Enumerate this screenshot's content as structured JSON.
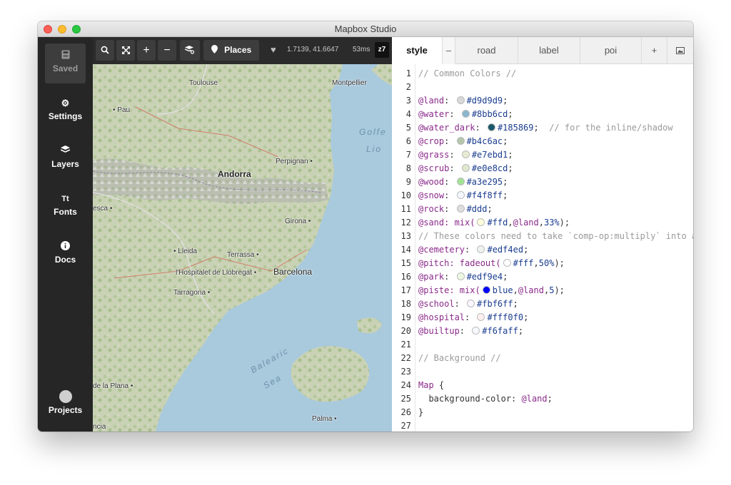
{
  "window": {
    "title": "Mapbox Studio"
  },
  "sidebar": {
    "items": [
      {
        "label": "Saved",
        "icon": "save-icon"
      },
      {
        "label": "Settings",
        "icon": "gear-icon"
      },
      {
        "label": "Layers",
        "icon": "layers-icon"
      },
      {
        "label": "Fonts",
        "icon": "fonts-icon"
      },
      {
        "label": "Docs",
        "icon": "info-icon"
      },
      {
        "label": "Projects",
        "icon": "avatar"
      }
    ]
  },
  "map_toolbar": {
    "places_label": "Places",
    "coordinates": "1.7139, 41.6647",
    "render_time": "53ms",
    "zoom_level": "z7"
  },
  "map": {
    "places": {
      "toulouse": "Toulouse",
      "montpellier": "Montpellier",
      "pau": "Pau",
      "andorra": "Andorra",
      "perpignan": "Perpignan",
      "huesca": "esca",
      "girona": "Girona",
      "lleida": "Lleida",
      "terrassa": "Terrassa",
      "hospitalet": "l'Hospitalet de Llobregat",
      "barcelona": "Barcelona",
      "tarragona": "Tarragona",
      "plana": "de la Plana",
      "palma": "Palma",
      "valencia": "ncia"
    },
    "seas": {
      "golfe_1": "Golfe",
      "golfe_2": "Lio",
      "balearic_1": "Balearic",
      "balearic_2": "Sea"
    }
  },
  "editor": {
    "tabs": [
      {
        "label": "style"
      },
      {
        "label": "–"
      },
      {
        "label": "road"
      },
      {
        "label": "label"
      },
      {
        "label": "poi"
      },
      {
        "label": "+"
      }
    ],
    "lines": [
      {
        "n": "1",
        "parts": [
          {
            "t": "// Common Colors //",
            "c": "comment"
          }
        ]
      },
      {
        "n": "2",
        "parts": []
      },
      {
        "n": "3",
        "parts": [
          {
            "t": "@land",
            "c": "var"
          },
          {
            "t": ": ",
            "c": "plain"
          },
          {
            "sw": "#d9d9d9"
          },
          {
            "t": "#d9d9d9",
            "c": "val"
          },
          {
            "t": ";",
            "c": "plain"
          }
        ]
      },
      {
        "n": "4",
        "parts": [
          {
            "t": "@water",
            "c": "var"
          },
          {
            "t": ": ",
            "c": "plain"
          },
          {
            "sw": "#8bb6cd"
          },
          {
            "t": "#8bb6cd",
            "c": "val"
          },
          {
            "t": ";",
            "c": "plain"
          }
        ]
      },
      {
        "n": "5",
        "parts": [
          {
            "t": "@water_dark",
            "c": "var"
          },
          {
            "t": ": ",
            "c": "plain"
          },
          {
            "sw": "#185869"
          },
          {
            "t": "#185869",
            "c": "val"
          },
          {
            "t": ";  ",
            "c": "plain"
          },
          {
            "t": "// for the inline/shadow",
            "c": "comment"
          }
        ]
      },
      {
        "n": "6",
        "parts": [
          {
            "t": "@crop",
            "c": "var"
          },
          {
            "t": ": ",
            "c": "plain"
          },
          {
            "sw": "#b4c6ac"
          },
          {
            "t": "#b4c6ac",
            "c": "val"
          },
          {
            "t": ";",
            "c": "plain"
          }
        ]
      },
      {
        "n": "7",
        "parts": [
          {
            "t": "@grass",
            "c": "var"
          },
          {
            "t": ": ",
            "c": "plain"
          },
          {
            "sw": "#e7ebd1"
          },
          {
            "t": "#e7ebd1",
            "c": "val"
          },
          {
            "t": ";",
            "c": "plain"
          }
        ]
      },
      {
        "n": "8",
        "parts": [
          {
            "t": "@scrub",
            "c": "var"
          },
          {
            "t": ": ",
            "c": "plain"
          },
          {
            "sw": "#e0e8cd"
          },
          {
            "t": "#e0e8cd",
            "c": "val"
          },
          {
            "t": ";",
            "c": "plain"
          }
        ]
      },
      {
        "n": "9",
        "parts": [
          {
            "t": "@wood",
            "c": "var"
          },
          {
            "t": ": ",
            "c": "plain"
          },
          {
            "sw": "#a3e295"
          },
          {
            "t": "#a3e295",
            "c": "val"
          },
          {
            "t": ";",
            "c": "plain"
          }
        ]
      },
      {
        "n": "10",
        "parts": [
          {
            "t": "@snow",
            "c": "var"
          },
          {
            "t": ": ",
            "c": "plain"
          },
          {
            "sw": "#f4f8ff"
          },
          {
            "t": "#f4f8ff",
            "c": "val"
          },
          {
            "t": ";",
            "c": "plain"
          }
        ]
      },
      {
        "n": "11",
        "parts": [
          {
            "t": "@rock",
            "c": "var"
          },
          {
            "t": ": ",
            "c": "plain"
          },
          {
            "sw": "#dddddd"
          },
          {
            "t": "#ddd",
            "c": "val"
          },
          {
            "t": ";",
            "c": "plain"
          }
        ]
      },
      {
        "n": "12",
        "parts": [
          {
            "t": "@sand",
            "c": "var"
          },
          {
            "t": ": mix(",
            "c": "kw"
          },
          {
            "sw": "#ffffdd"
          },
          {
            "t": "#ffd",
            "c": "val"
          },
          {
            "t": ",",
            "c": "plain"
          },
          {
            "t": "@land",
            "c": "var"
          },
          {
            "t": ",",
            "c": "plain"
          },
          {
            "t": "33%",
            "c": "val"
          },
          {
            "t": ");",
            "c": "plain"
          }
        ]
      },
      {
        "n": "13",
        "parts": [
          {
            "t": "// These colors need to take `comp-op:multiply` into acc",
            "c": "comment"
          }
        ]
      },
      {
        "n": "14",
        "parts": [
          {
            "t": "@cemetery",
            "c": "var"
          },
          {
            "t": ": ",
            "c": "plain"
          },
          {
            "sw": "#edf4ed"
          },
          {
            "t": "#edf4ed",
            "c": "val"
          },
          {
            "t": ";",
            "c": "plain"
          }
        ]
      },
      {
        "n": "15",
        "parts": [
          {
            "t": "@pitch",
            "c": "var"
          },
          {
            "t": ": fadeout(",
            "c": "kw"
          },
          {
            "sw": "#ffffff"
          },
          {
            "t": "#fff",
            "c": "val"
          },
          {
            "t": ",",
            "c": "plain"
          },
          {
            "t": "50%",
            "c": "val"
          },
          {
            "t": ");",
            "c": "plain"
          }
        ]
      },
      {
        "n": "16",
        "parts": [
          {
            "t": "@park",
            "c": "var"
          },
          {
            "t": ": ",
            "c": "plain"
          },
          {
            "sw": "#edf9e4"
          },
          {
            "t": "#edf9e4",
            "c": "val"
          },
          {
            "t": ";",
            "c": "plain"
          }
        ]
      },
      {
        "n": "17",
        "parts": [
          {
            "t": "@piste",
            "c": "var"
          },
          {
            "t": ": mix(",
            "c": "kw"
          },
          {
            "sw": "#0000ff"
          },
          {
            "t": "blue",
            "c": "val"
          },
          {
            "t": ",",
            "c": "plain"
          },
          {
            "t": "@land",
            "c": "var"
          },
          {
            "t": ",",
            "c": "plain"
          },
          {
            "t": "5",
            "c": "val"
          },
          {
            "t": ");",
            "c": "plain"
          }
        ]
      },
      {
        "n": "18",
        "parts": [
          {
            "t": "@school",
            "c": "var"
          },
          {
            "t": ": ",
            "c": "plain"
          },
          {
            "sw": "#fbf6ff"
          },
          {
            "t": "#fbf6ff",
            "c": "val"
          },
          {
            "t": ";",
            "c": "plain"
          }
        ]
      },
      {
        "n": "19",
        "parts": [
          {
            "t": "@hospital",
            "c": "var"
          },
          {
            "t": ": ",
            "c": "plain"
          },
          {
            "sw": "#fff0f0"
          },
          {
            "t": "#fff0f0",
            "c": "val"
          },
          {
            "t": ";",
            "c": "plain"
          }
        ]
      },
      {
        "n": "20",
        "parts": [
          {
            "t": "@builtup",
            "c": "var"
          },
          {
            "t": ": ",
            "c": "plain"
          },
          {
            "sw": "#f6faff"
          },
          {
            "t": "#f6faff",
            "c": "val"
          },
          {
            "t": ";",
            "c": "plain"
          }
        ]
      },
      {
        "n": "21",
        "parts": []
      },
      {
        "n": "22",
        "parts": [
          {
            "t": "// Background //",
            "c": "comment"
          }
        ]
      },
      {
        "n": "23",
        "parts": []
      },
      {
        "n": "24",
        "parts": [
          {
            "t": "Map",
            "c": "kw"
          },
          {
            "t": " {",
            "c": "plain"
          }
        ]
      },
      {
        "n": "25",
        "parts": [
          {
            "t": "  background-color: ",
            "c": "plain"
          },
          {
            "t": "@land",
            "c": "var"
          },
          {
            "t": ";",
            "c": "plain"
          }
        ]
      },
      {
        "n": "26",
        "parts": [
          {
            "t": "}",
            "c": "plain"
          }
        ]
      },
      {
        "n": "27",
        "parts": []
      }
    ]
  },
  "colors": {
    "sidebar_bg": "#262626",
    "toolbar_bg": "#2b2b2b",
    "map_sea": "#a9c9dd",
    "map_land": "#c8cfb6",
    "var_color": "#8a2a8a",
    "value_color": "#1a3d8f",
    "comment_color": "#9a9a9a"
  }
}
